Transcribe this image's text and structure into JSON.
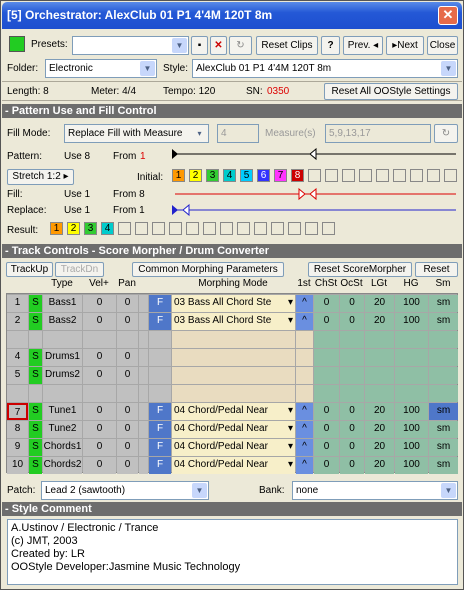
{
  "window": {
    "title": "[5] Orchestrator: AlexClub 01 P1 4'4M 120T 8m"
  },
  "toolbar": {
    "presets_label": "Presets:",
    "presets_value": "",
    "reset_clips": "Reset Clips",
    "help": "?",
    "prev": "Prev.",
    "next": "Next",
    "close": "Close"
  },
  "folder": {
    "label": "Folder:",
    "value": "Electronic"
  },
  "style": {
    "label": "Style:",
    "value": "AlexClub 01 P1 4'4M 120T 8m"
  },
  "info": {
    "length": "Length: 8",
    "meter": "Meter: 4/4",
    "tempo": "Tempo: 120",
    "sn_label": "SN:",
    "sn_value": "0350",
    "reset_all": "Reset All OOStyle Settings"
  },
  "pattern_section": {
    "title": "- Pattern Use and Fill Control",
    "fill_mode_label": "Fill Mode:",
    "fill_mode_value": "Replace Fill with Measure",
    "fill_num": "4",
    "measures_label": "Measure(s)",
    "measures_value": "5,9,13,17",
    "pattern_label": "Pattern:",
    "pattern_use": "Use  8",
    "pattern_from_label": "From",
    "pattern_from": "1",
    "stretch": "Stretch 1:2",
    "initial_label": "Initial:",
    "fill_label": "Fill:",
    "fill_use": "Use  1",
    "fill_from": "From 8",
    "replace_label": "Replace:",
    "replace_use": "Use  1",
    "replace_from": "From 1",
    "result_label": "Result:",
    "initial_squares": [
      "1",
      "2",
      "3",
      "4",
      "5",
      "6",
      "7",
      "8",
      "",
      "",
      "",
      "",
      "",
      "",
      "",
      "",
      ""
    ],
    "initial_colors": [
      "#ff9900",
      "#ffff00",
      "#33cc33",
      "#00cccc",
      "#00ccff",
      "#3333ff",
      "#ff33ff",
      "#cc0000"
    ],
    "result_squares": [
      "1",
      "2",
      "3",
      "4",
      "",
      "",
      "",
      "",
      "",
      "",
      "",
      "",
      "",
      "",
      "",
      "",
      ""
    ],
    "result_colors": [
      "#ff9900",
      "#ffff00",
      "#33cc33",
      "#00cccc"
    ]
  },
  "track_section": {
    "title": "- Track Controls - Score Morpher / Drum Converter",
    "trackup": "TrackUp",
    "trackdn": "TrackDn",
    "common": "Common Morphing Parameters",
    "reset_sm": "Reset ScoreMorpher",
    "reset": "Reset",
    "headers": [
      "Type",
      "Vel+",
      "Pan",
      "Morphing Mode",
      "1st",
      "ChSt",
      "OcSt",
      "LGt",
      "HG",
      "Sm"
    ],
    "rows": [
      {
        "n": "1",
        "s": "S",
        "type": "Bass1",
        "vel": "0",
        "pan": "0",
        "f": "F",
        "mode": "03 Bass All Chord Ste",
        "first": "^",
        "ch": "0",
        "oc": "0",
        "lgt": "20",
        "hg": "100",
        "sm": "sm"
      },
      {
        "n": "2",
        "s": "S",
        "type": "Bass2",
        "vel": "0",
        "pan": "0",
        "f": "F",
        "mode": "03 Bass All Chord Ste",
        "first": "^",
        "ch": "0",
        "oc": "0",
        "lgt": "20",
        "hg": "100",
        "sm": "sm"
      },
      {
        "n": "",
        "s": "",
        "type": "",
        "vel": "",
        "pan": "",
        "f": "",
        "mode": "",
        "first": "",
        "ch": "",
        "oc": "",
        "lgt": "",
        "hg": "",
        "sm": ""
      },
      {
        "n": "4",
        "s": "S",
        "type": "Drums1",
        "vel": "0",
        "pan": "0",
        "f": "",
        "mode": "",
        "first": "",
        "ch": "",
        "oc": "",
        "lgt": "",
        "hg": "",
        "sm": ""
      },
      {
        "n": "5",
        "s": "S",
        "type": "Drums2",
        "vel": "0",
        "pan": "0",
        "f": "",
        "mode": "",
        "first": "",
        "ch": "",
        "oc": "",
        "lgt": "",
        "hg": "",
        "sm": ""
      },
      {
        "n": "",
        "s": "",
        "type": "",
        "vel": "",
        "pan": "",
        "f": "",
        "mode": "",
        "first": "",
        "ch": "",
        "oc": "",
        "lgt": "",
        "hg": "",
        "sm": ""
      },
      {
        "n": "7",
        "s": "S",
        "type": "Tune1",
        "vel": "0",
        "pan": "0",
        "f": "F",
        "mode": "04 Chord/Pedal Near",
        "first": "^",
        "ch": "0",
        "oc": "0",
        "lgt": "20",
        "hg": "100",
        "sm": "sm"
      },
      {
        "n": "8",
        "s": "S",
        "type": "Tune2",
        "vel": "0",
        "pan": "0",
        "f": "F",
        "mode": "04 Chord/Pedal Near",
        "first": "^",
        "ch": "0",
        "oc": "0",
        "lgt": "20",
        "hg": "100",
        "sm": "sm"
      },
      {
        "n": "9",
        "s": "S",
        "type": "Chords1",
        "vel": "0",
        "pan": "0",
        "f": "F",
        "mode": "04 Chord/Pedal Near",
        "first": "^",
        "ch": "0",
        "oc": "0",
        "lgt": "20",
        "hg": "100",
        "sm": "sm"
      },
      {
        "n": "10",
        "s": "S",
        "type": "Chords2",
        "vel": "0",
        "pan": "0",
        "f": "F",
        "mode": "04 Chord/Pedal Near",
        "first": "^",
        "ch": "0",
        "oc": "0",
        "lgt": "20",
        "hg": "100",
        "sm": "sm"
      }
    ],
    "patch_label": "Patch:",
    "patch_value": "Lead 2 (sawtooth)",
    "bank_label": "Bank:",
    "bank_value": "none"
  },
  "comment_section": {
    "title": "- Style Comment",
    "lines": [
      "A.Ustinov / Electronic / Trance",
      "(c) JMT, 2003",
      "Created by: LR",
      "OOStyle Developer:Jasmine Music Technology"
    ]
  }
}
